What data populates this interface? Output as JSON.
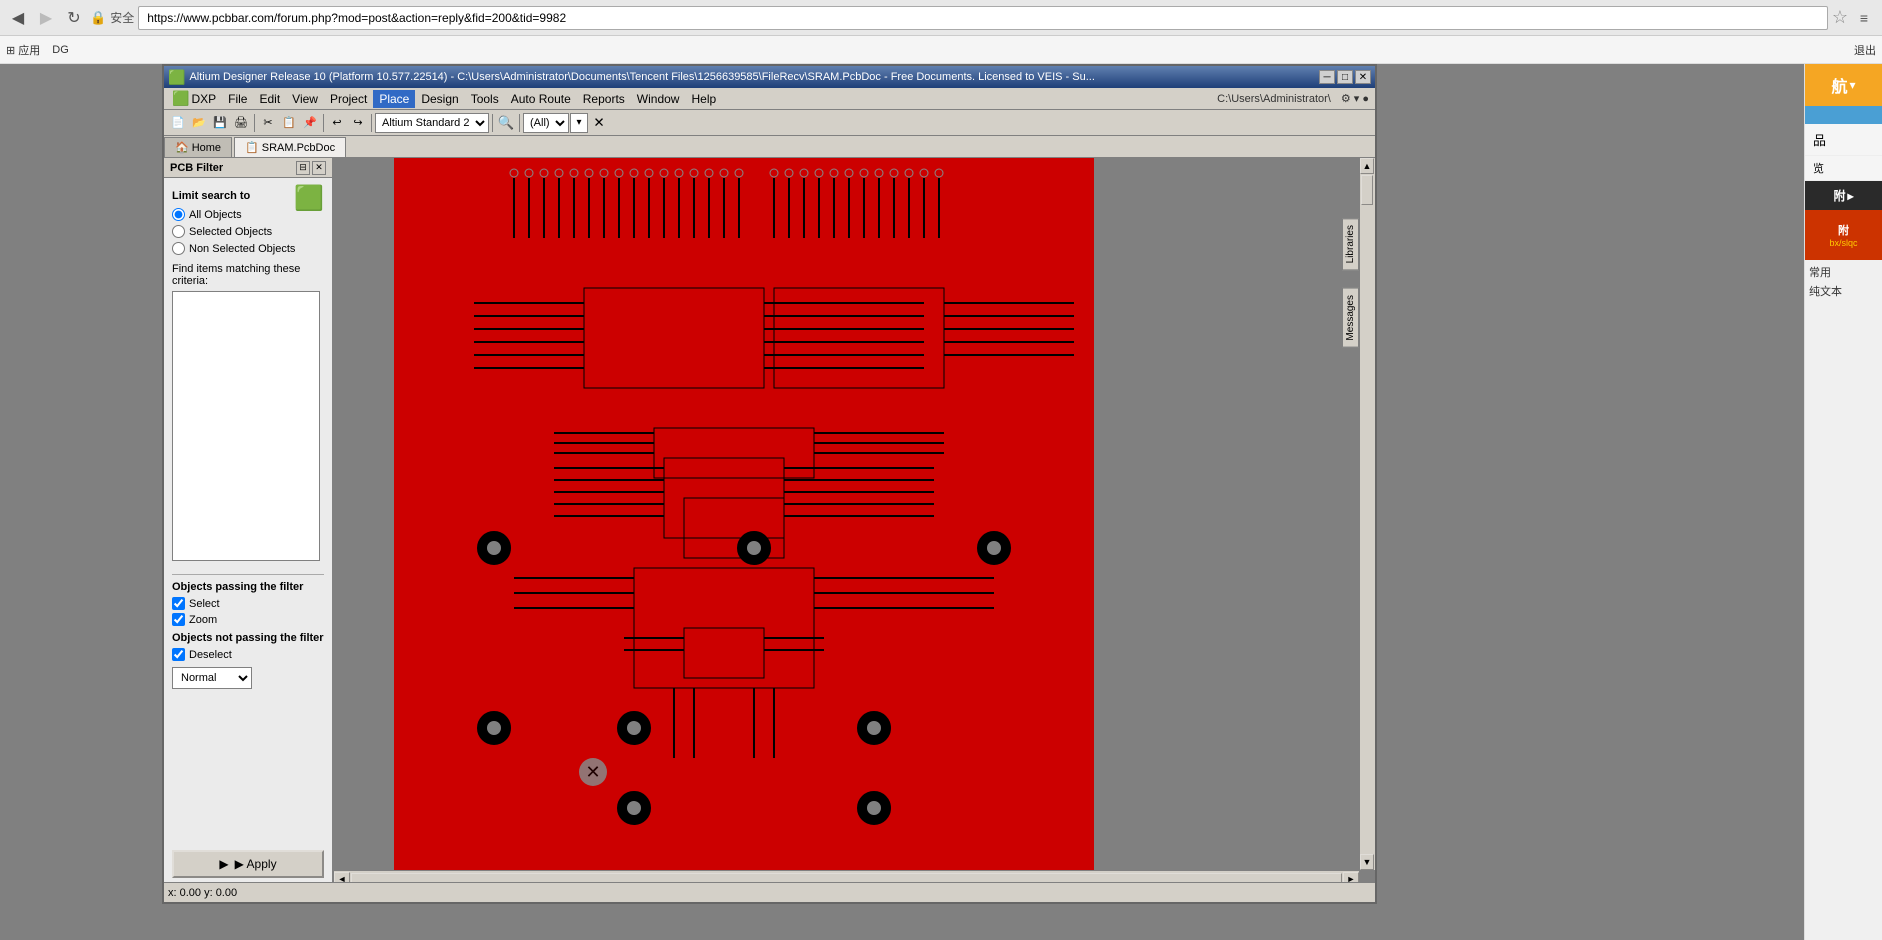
{
  "browser": {
    "back_btn": "◀",
    "forward_btn": "▶",
    "reload_btn": "↺",
    "security_icon": "🔒",
    "address": "https://www.pcbbar.com/forum.php?mod=post&action=reply&fid=200&tid=9982",
    "star_icon": "☆",
    "bookmarks": [
      {
        "icon": "⊞",
        "label": "应用"
      },
      {
        "icon": "📄",
        "label": "DGUI"
      },
      {
        "label": "退出"
      }
    ]
  },
  "app": {
    "title": "Altium Designer Release 10 (Platform 10.577.22514) - C:\\Users\\Administrator\\Documents\\Tencent Files\\1256639585\\FileRecv\\SRAM.PcbDoc - Free Documents. Licensed to VEIS - Su...",
    "icon": "🟩",
    "controls": {
      "minimize": "─",
      "maximize": "□",
      "close": "✕"
    }
  },
  "menubar": {
    "items": [
      "DXP",
      "File",
      "Edit",
      "View",
      "Project",
      "Place",
      "Design",
      "Tools",
      "Auto Route",
      "Reports",
      "Window",
      "Help"
    ]
  },
  "toolbar": {
    "dropdown1": "Altium Standard 2",
    "dropdown2": "(All)"
  },
  "tabs": [
    {
      "icon": "🏠",
      "label": "Home"
    },
    {
      "icon": "📋",
      "label": "SRAM.PcbDoc"
    }
  ],
  "pcb_filter": {
    "title": "PCB Filter",
    "limit_search_label": "Limit search to",
    "radio_options": [
      {
        "label": "All Objects",
        "selected": true
      },
      {
        "label": "Selected Objects",
        "selected": false
      },
      {
        "label": "Non Selected Objects",
        "selected": false
      }
    ],
    "criteria_label": "Find items matching these criteria:",
    "criteria_value": "",
    "objects_passing_label": "Objects passing the filter",
    "select_label": "Select",
    "select_checked": true,
    "zoom_label": "Zoom",
    "zoom_checked": true,
    "objects_not_passing_label": "Objects not passing the filter",
    "deselect_label": "Deselect",
    "deselect_checked": true,
    "normal_label": "Normal",
    "apply_label": "▶  Apply"
  },
  "right_tabs": {
    "libraries": "Libraries",
    "messages": "Messages"
  },
  "right_nav": {
    "nav_label": "航",
    "items": [
      "品",
      "览"
    ],
    "dark_text": "附",
    "bottom_text": "常用\n纯文本"
  },
  "colors": {
    "pcb_red": "#cc0000",
    "pcb_bg": "#808080",
    "pcb_trace": "#000000",
    "panel_bg": "#f0f0f0",
    "menubar_bg": "#d4d0c8"
  }
}
